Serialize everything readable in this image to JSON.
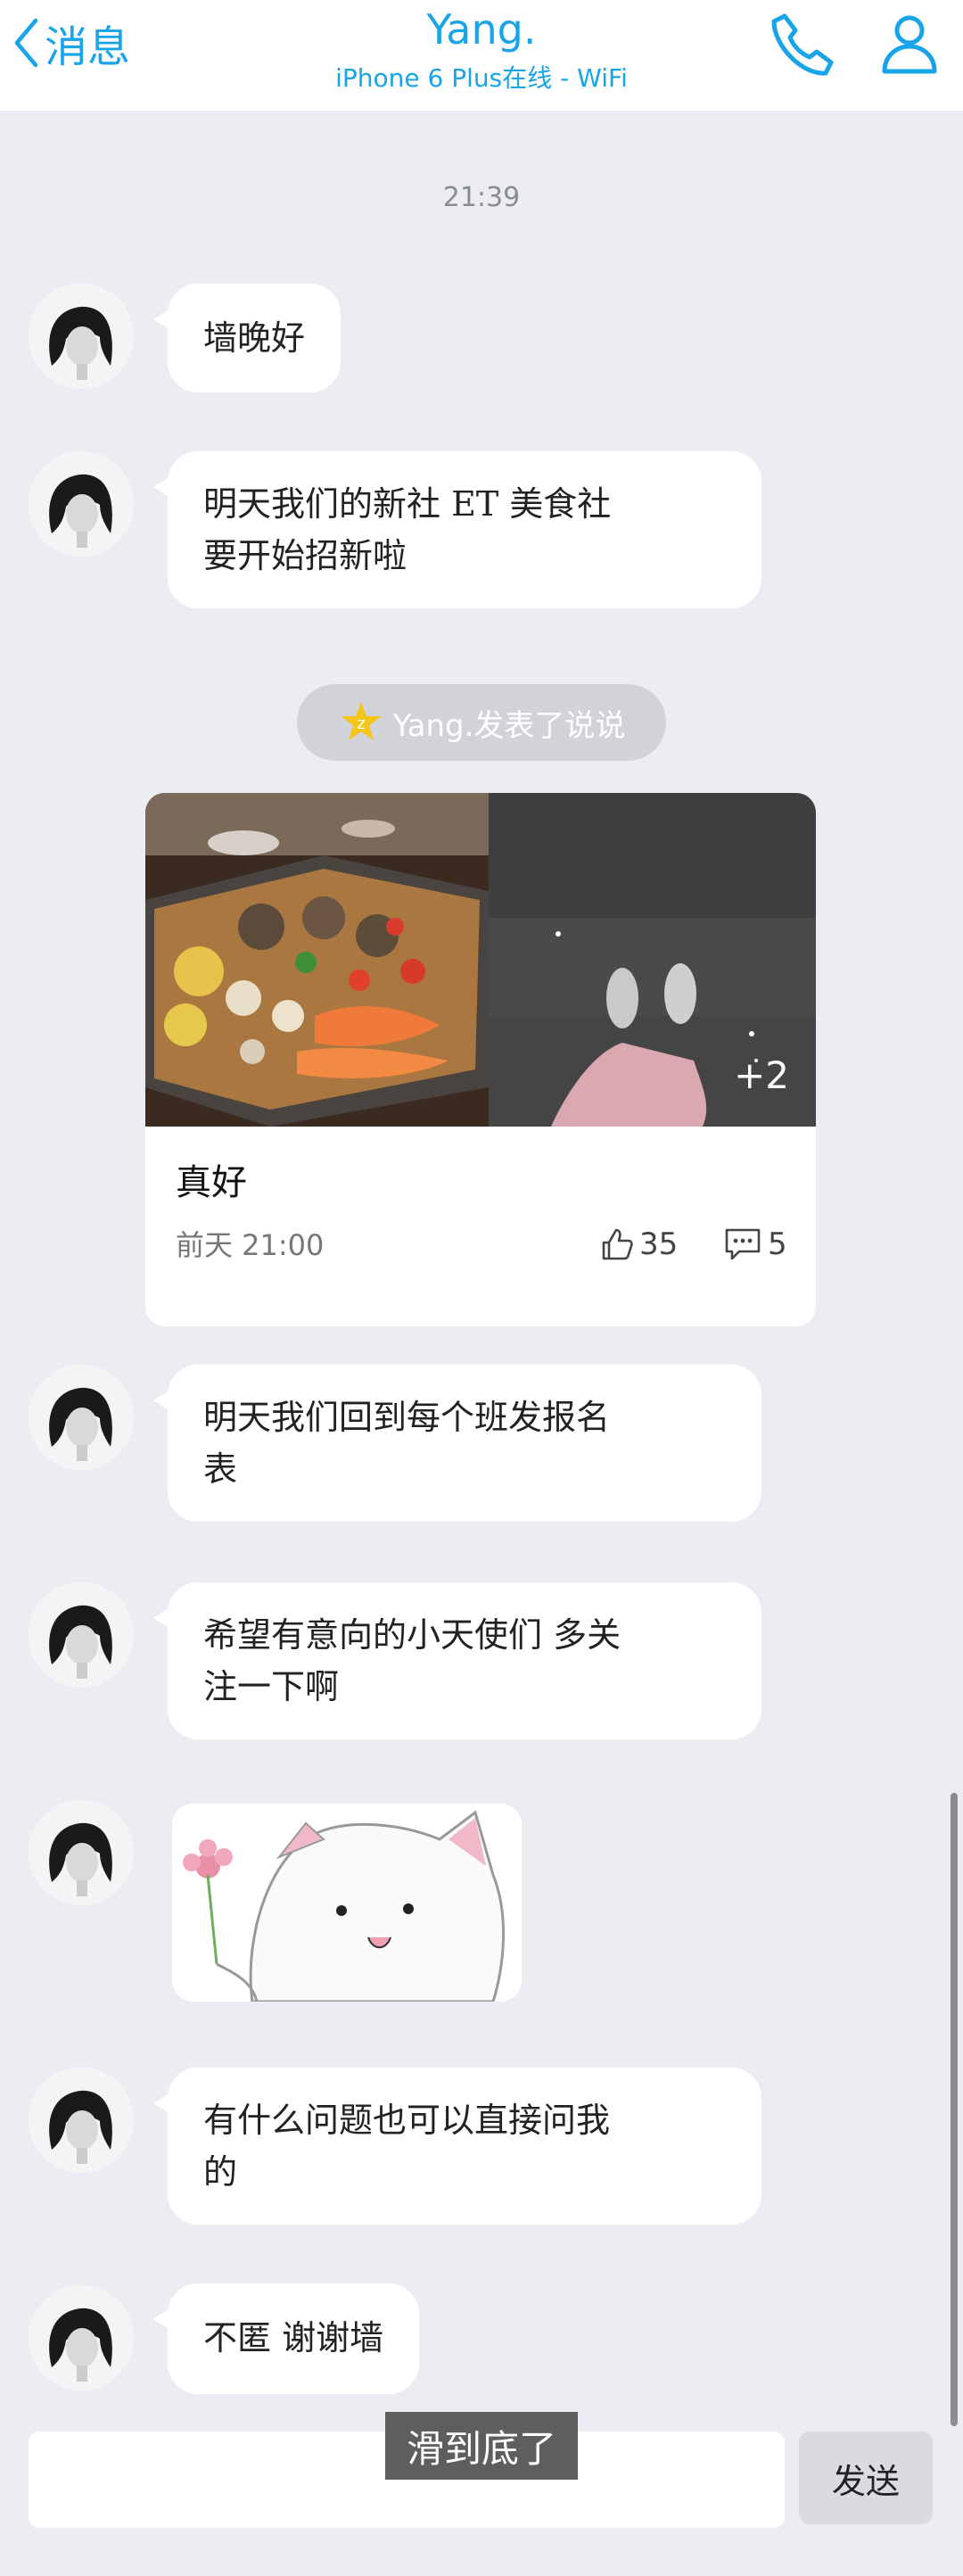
{
  "header": {
    "back_label": "消息",
    "title": "Yang.",
    "subtitle": "iPhone 6 Plus在线 - WiFi"
  },
  "timestamp": "21:39",
  "messages": [
    {
      "lines": [
        "墙晚好"
      ]
    },
    {
      "lines": [
        "明天我们的新社 ET 美食社",
        "要开始招新啦"
      ]
    },
    {
      "lines": [
        "明天我们回到每个班发报名",
        "表"
      ]
    },
    {
      "lines": [
        "希望有意向的小天使们 多关",
        "注一下啊"
      ]
    },
    {
      "lines": [
        "有什么问题也可以直接问我",
        "的"
      ]
    },
    {
      "lines": [
        "不匿 谢谢墙"
      ]
    }
  ],
  "share_notice": "Yang.发表了说说",
  "post": {
    "text": "真好",
    "date": "前天 21:00",
    "likes": "35",
    "comments": "5",
    "more_images": "+2"
  },
  "input": {
    "send_label": "发送"
  },
  "toast": "滑到底了",
  "colors": {
    "accent": "#17A4E8",
    "background": "#ECEDF3"
  }
}
